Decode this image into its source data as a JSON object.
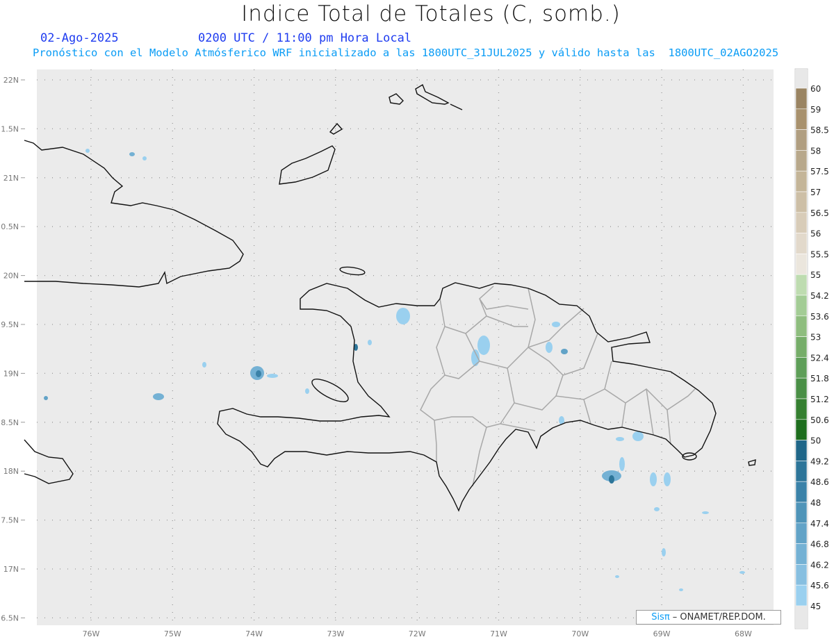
{
  "header": {
    "title": "Indice Total de Totales (C, somb.)",
    "date": "02-Ago-2025",
    "time": "0200 UTC / 11:00 pm Hora Local",
    "description": "Pronóstico con el Modelo Atmósferico WRF inicializado a las 1800UTC_31JUL2025 y válido hasta las  1800UTC_02AGO2025"
  },
  "axes": {
    "lat_labels": [
      "22N",
      "1.5N",
      "21N",
      "0.5N",
      "20N",
      "9.5N",
      "19N",
      "8.5N",
      "18N",
      "7.5N",
      "17N",
      "6.5N"
    ],
    "lon_labels": [
      "76W",
      "75W",
      "74W",
      "73W",
      "72W",
      "71W",
      "70W",
      "69W",
      "68W"
    ]
  },
  "colorbar": {
    "labels": [
      "60",
      "59",
      "58.5",
      "58",
      "57.5",
      "57",
      "56.5",
      "56",
      "55.5",
      "55",
      "54.2",
      "53.6",
      "53",
      "52.4",
      "51.8",
      "51.2",
      "50.6",
      "50",
      "49.2",
      "48.6",
      "48",
      "47.4",
      "46.8",
      "46.2",
      "45.6",
      "45"
    ],
    "colors": [
      "#9a8462",
      "#a8916d",
      "#b09e80",
      "#b8a88b",
      "#c4b598",
      "#cdbfa6",
      "#d8ccb8",
      "#e2d9cb",
      "#ebe6dd",
      "#bedcb0",
      "#a3cc95",
      "#8ebd7e",
      "#76ad69",
      "#5e9e58",
      "#4a8f46",
      "#357f30",
      "#1e6e1e",
      "#1f6688",
      "#2d7599",
      "#3b82a8",
      "#4f94b8",
      "#62a3c7",
      "#74b1d4",
      "#87bfe0",
      "#9ad0ef"
    ],
    "end_color": "#e8e8e8"
  },
  "credit": {
    "brand": "Sisπ",
    "text": " –  ONAMET/REP.DOM."
  }
}
